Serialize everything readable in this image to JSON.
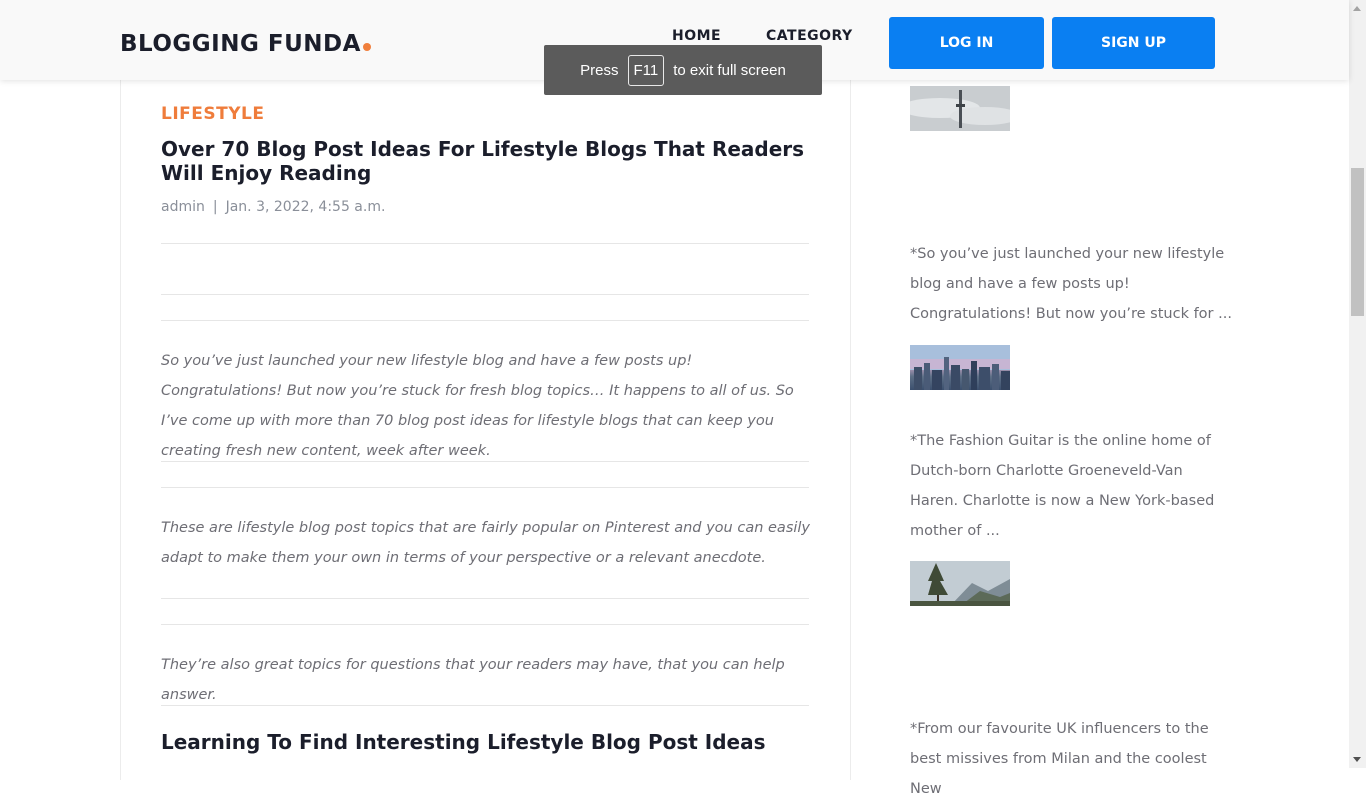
{
  "header": {
    "logo_text": "BLOGGING FUNDA",
    "nav": {
      "home": "HOME",
      "category": "CATEGORY"
    },
    "login_label": "LOG IN",
    "signup_label": "SIGN UP"
  },
  "fullscreen_notice": {
    "prefix": "Press",
    "key": "F11",
    "suffix": "to exit full screen"
  },
  "article": {
    "category": "LIFESTYLE",
    "title": "Over 70 Blog Post Ideas For Lifestyle Blogs That Readers Will Enjoy Reading",
    "author": "admin",
    "separator": "|",
    "date": "Jan. 3, 2022, 4:55 a.m.",
    "paragraphs": [
      "So you’ve just launched your new lifestyle blog and have a few posts up! Congratulations! But now you’re stuck for fresh blog topics… It happens to all of us. So I’ve come up with more than 70 blog post ideas for lifestyle blogs that can keep you creating fresh new content, week after week.",
      "These are lifestyle blog post topics that are fairly popular on Pinterest and you can easily adapt to make them your own in terms of your perspective or a relevant anecdote.",
      "They’re also great topics for questions that your readers may have, that you can help answer."
    ],
    "subheading": "Learning To Find Interesting Lifestyle Blog Post Ideas"
  },
  "sidebar": {
    "excerpts": [
      "*So you’ve just launched your new lifestyle blog and have a few posts up! Congratulations! But now you’re stuck for ...",
      "*The Fashion Guitar is the online home of Dutch-born Charlotte Groeneveld-Van Haren. Charlotte is now a New York-based mother of ...",
      "*From our favourite UK influencers to the best missives from Milan and the coolest New"
    ]
  },
  "colors": {
    "accent_orange": "#ef7c3b",
    "button_blue": "#0a7ff2",
    "heading_dark": "#1b1e2b"
  }
}
